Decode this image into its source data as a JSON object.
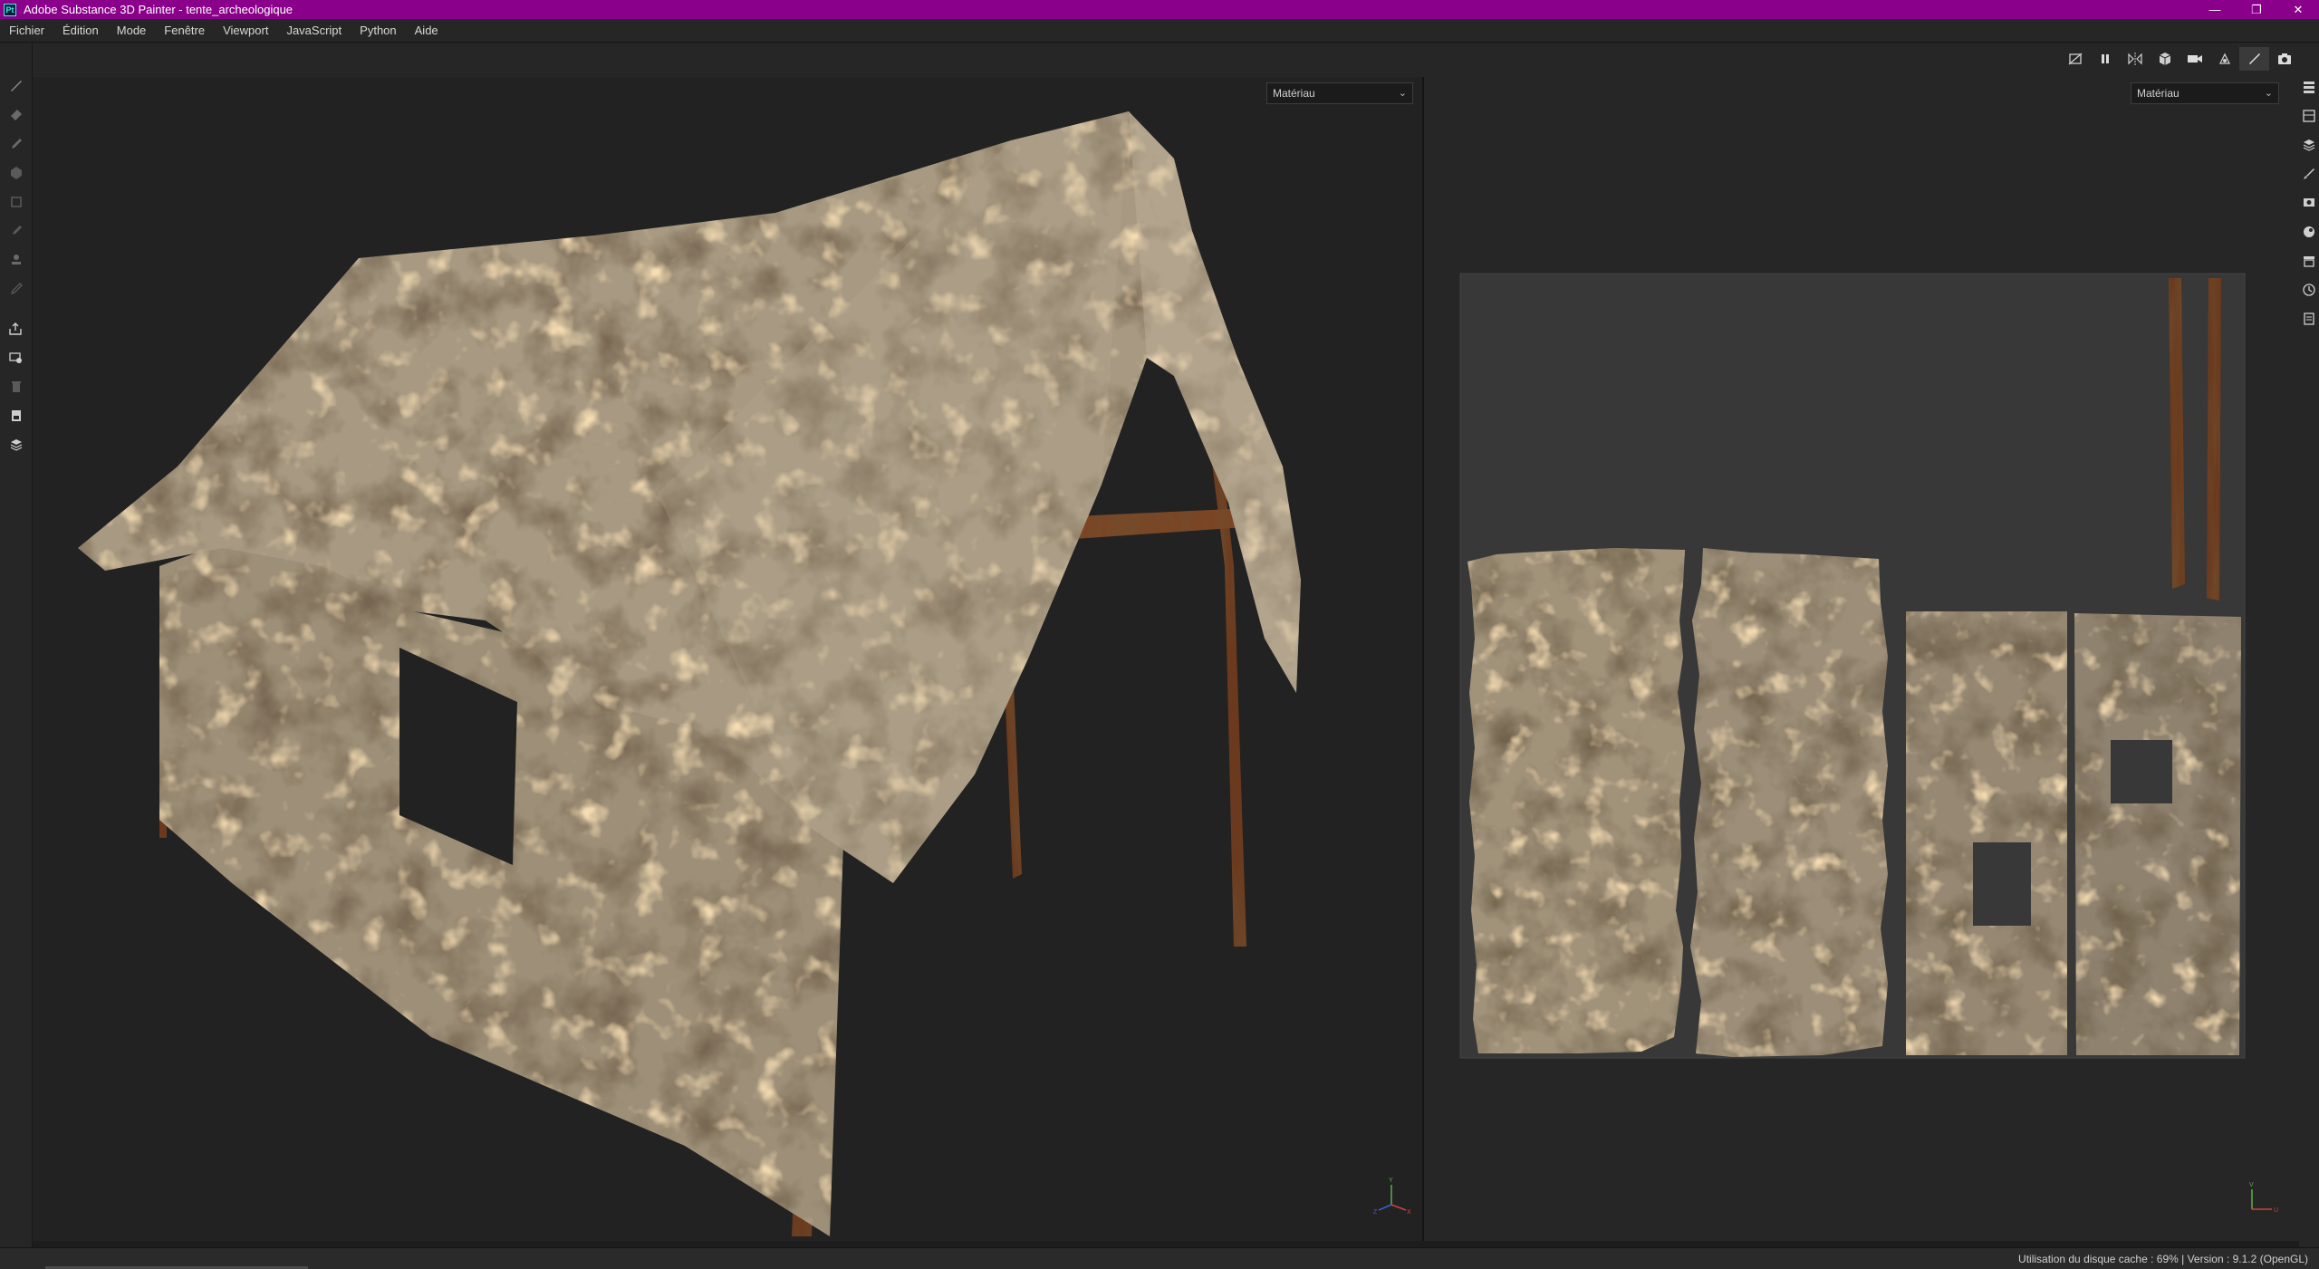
{
  "window": {
    "app_icon": "Pt",
    "title": "Adobe Substance 3D Painter - tente_archeologique",
    "controls": {
      "minimize": "—",
      "maximize": "❐",
      "close": "✕"
    }
  },
  "menu": [
    "Fichier",
    "Édition",
    "Mode",
    "Fenêtre",
    "Viewport",
    "JavaScript",
    "Python",
    "Aide"
  ],
  "viewport3d": {
    "channel_select": "Matériau"
  },
  "viewport2d": {
    "channel_select": "Matériau"
  },
  "left_tools": [
    "paint-brush-icon",
    "eraser-icon",
    "projection-icon",
    "geometry-mask-icon",
    "polygon-fill-icon",
    "smudge-icon",
    "clone-stamp-icon",
    "color-picker-icon",
    "bake-export-icon",
    "material-picker-icon",
    "trash-icon",
    "save-icon",
    "3d-view-icon"
  ],
  "right_tools": [
    "layers-icon",
    "texture-set-icon",
    "stack-icon",
    "brush-settings-icon",
    "display-settings-icon",
    "environment-icon",
    "shelf-icon",
    "history-icon",
    "log-icon"
  ],
  "top_toolbar": [
    "hide-ui-icon",
    "pause-icon",
    "symmetry-icon",
    "cube-icon",
    "camera-icon",
    "render-icon",
    "paint-mode-icon",
    "screenshot-icon"
  ],
  "status": {
    "text": "Utilisation du disque cache :  69% | Version : 9.1.2 (OpenGL)",
    "cache_usage": 0.69
  },
  "colors": {
    "titlebar": "#8b008b",
    "background": "#222222",
    "panel": "#262626"
  }
}
